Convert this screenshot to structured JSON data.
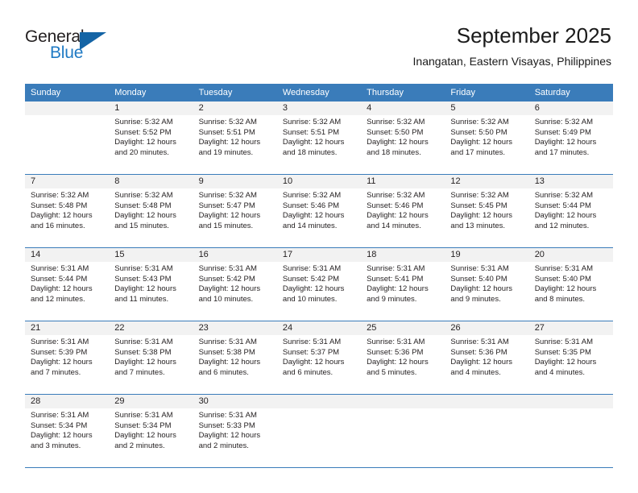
{
  "brand": {
    "name_top": "General",
    "name_bottom": "Blue",
    "flag_color": "#1464a5",
    "blue_color": "#1f7ac4"
  },
  "header": {
    "title": "September 2025",
    "subtitle": "Inangatan, Eastern Visayas, Philippines",
    "accent_color": "#3a7cba"
  },
  "calendar": {
    "weekday_headers": [
      "Sunday",
      "Monday",
      "Tuesday",
      "Wednesday",
      "Thursday",
      "Friday",
      "Saturday"
    ],
    "labels": {
      "sunrise_prefix": "Sunrise:",
      "sunset_prefix": "Sunset:",
      "daylight_prefix": "Daylight:"
    },
    "weeks": [
      [
        {
          "day": "",
          "sunrise": "",
          "sunset": "",
          "daylight_line1": "",
          "daylight_line2": ""
        },
        {
          "day": "1",
          "sunrise": "Sunrise: 5:32 AM",
          "sunset": "Sunset: 5:52 PM",
          "daylight_line1": "Daylight: 12 hours",
          "daylight_line2": "and 20 minutes."
        },
        {
          "day": "2",
          "sunrise": "Sunrise: 5:32 AM",
          "sunset": "Sunset: 5:51 PM",
          "daylight_line1": "Daylight: 12 hours",
          "daylight_line2": "and 19 minutes."
        },
        {
          "day": "3",
          "sunrise": "Sunrise: 5:32 AM",
          "sunset": "Sunset: 5:51 PM",
          "daylight_line1": "Daylight: 12 hours",
          "daylight_line2": "and 18 minutes."
        },
        {
          "day": "4",
          "sunrise": "Sunrise: 5:32 AM",
          "sunset": "Sunset: 5:50 PM",
          "daylight_line1": "Daylight: 12 hours",
          "daylight_line2": "and 18 minutes."
        },
        {
          "day": "5",
          "sunrise": "Sunrise: 5:32 AM",
          "sunset": "Sunset: 5:50 PM",
          "daylight_line1": "Daylight: 12 hours",
          "daylight_line2": "and 17 minutes."
        },
        {
          "day": "6",
          "sunrise": "Sunrise: 5:32 AM",
          "sunset": "Sunset: 5:49 PM",
          "daylight_line1": "Daylight: 12 hours",
          "daylight_line2": "and 17 minutes."
        }
      ],
      [
        {
          "day": "7",
          "sunrise": "Sunrise: 5:32 AM",
          "sunset": "Sunset: 5:48 PM",
          "daylight_line1": "Daylight: 12 hours",
          "daylight_line2": "and 16 minutes."
        },
        {
          "day": "8",
          "sunrise": "Sunrise: 5:32 AM",
          "sunset": "Sunset: 5:48 PM",
          "daylight_line1": "Daylight: 12 hours",
          "daylight_line2": "and 15 minutes."
        },
        {
          "day": "9",
          "sunrise": "Sunrise: 5:32 AM",
          "sunset": "Sunset: 5:47 PM",
          "daylight_line1": "Daylight: 12 hours",
          "daylight_line2": "and 15 minutes."
        },
        {
          "day": "10",
          "sunrise": "Sunrise: 5:32 AM",
          "sunset": "Sunset: 5:46 PM",
          "daylight_line1": "Daylight: 12 hours",
          "daylight_line2": "and 14 minutes."
        },
        {
          "day": "11",
          "sunrise": "Sunrise: 5:32 AM",
          "sunset": "Sunset: 5:46 PM",
          "daylight_line1": "Daylight: 12 hours",
          "daylight_line2": "and 14 minutes."
        },
        {
          "day": "12",
          "sunrise": "Sunrise: 5:32 AM",
          "sunset": "Sunset: 5:45 PM",
          "daylight_line1": "Daylight: 12 hours",
          "daylight_line2": "and 13 minutes."
        },
        {
          "day": "13",
          "sunrise": "Sunrise: 5:32 AM",
          "sunset": "Sunset: 5:44 PM",
          "daylight_line1": "Daylight: 12 hours",
          "daylight_line2": "and 12 minutes."
        }
      ],
      [
        {
          "day": "14",
          "sunrise": "Sunrise: 5:31 AM",
          "sunset": "Sunset: 5:44 PM",
          "daylight_line1": "Daylight: 12 hours",
          "daylight_line2": "and 12 minutes."
        },
        {
          "day": "15",
          "sunrise": "Sunrise: 5:31 AM",
          "sunset": "Sunset: 5:43 PM",
          "daylight_line1": "Daylight: 12 hours",
          "daylight_line2": "and 11 minutes."
        },
        {
          "day": "16",
          "sunrise": "Sunrise: 5:31 AM",
          "sunset": "Sunset: 5:42 PM",
          "daylight_line1": "Daylight: 12 hours",
          "daylight_line2": "and 10 minutes."
        },
        {
          "day": "17",
          "sunrise": "Sunrise: 5:31 AM",
          "sunset": "Sunset: 5:42 PM",
          "daylight_line1": "Daylight: 12 hours",
          "daylight_line2": "and 10 minutes."
        },
        {
          "day": "18",
          "sunrise": "Sunrise: 5:31 AM",
          "sunset": "Sunset: 5:41 PM",
          "daylight_line1": "Daylight: 12 hours",
          "daylight_line2": "and 9 minutes."
        },
        {
          "day": "19",
          "sunrise": "Sunrise: 5:31 AM",
          "sunset": "Sunset: 5:40 PM",
          "daylight_line1": "Daylight: 12 hours",
          "daylight_line2": "and 9 minutes."
        },
        {
          "day": "20",
          "sunrise": "Sunrise: 5:31 AM",
          "sunset": "Sunset: 5:40 PM",
          "daylight_line1": "Daylight: 12 hours",
          "daylight_line2": "and 8 minutes."
        }
      ],
      [
        {
          "day": "21",
          "sunrise": "Sunrise: 5:31 AM",
          "sunset": "Sunset: 5:39 PM",
          "daylight_line1": "Daylight: 12 hours",
          "daylight_line2": "and 7 minutes."
        },
        {
          "day": "22",
          "sunrise": "Sunrise: 5:31 AM",
          "sunset": "Sunset: 5:38 PM",
          "daylight_line1": "Daylight: 12 hours",
          "daylight_line2": "and 7 minutes."
        },
        {
          "day": "23",
          "sunrise": "Sunrise: 5:31 AM",
          "sunset": "Sunset: 5:38 PM",
          "daylight_line1": "Daylight: 12 hours",
          "daylight_line2": "and 6 minutes."
        },
        {
          "day": "24",
          "sunrise": "Sunrise: 5:31 AM",
          "sunset": "Sunset: 5:37 PM",
          "daylight_line1": "Daylight: 12 hours",
          "daylight_line2": "and 6 minutes."
        },
        {
          "day": "25",
          "sunrise": "Sunrise: 5:31 AM",
          "sunset": "Sunset: 5:36 PM",
          "daylight_line1": "Daylight: 12 hours",
          "daylight_line2": "and 5 minutes."
        },
        {
          "day": "26",
          "sunrise": "Sunrise: 5:31 AM",
          "sunset": "Sunset: 5:36 PM",
          "daylight_line1": "Daylight: 12 hours",
          "daylight_line2": "and 4 minutes."
        },
        {
          "day": "27",
          "sunrise": "Sunrise: 5:31 AM",
          "sunset": "Sunset: 5:35 PM",
          "daylight_line1": "Daylight: 12 hours",
          "daylight_line2": "and 4 minutes."
        }
      ],
      [
        {
          "day": "28",
          "sunrise": "Sunrise: 5:31 AM",
          "sunset": "Sunset: 5:34 PM",
          "daylight_line1": "Daylight: 12 hours",
          "daylight_line2": "and 3 minutes."
        },
        {
          "day": "29",
          "sunrise": "Sunrise: 5:31 AM",
          "sunset": "Sunset: 5:34 PM",
          "daylight_line1": "Daylight: 12 hours",
          "daylight_line2": "and 2 minutes."
        },
        {
          "day": "30",
          "sunrise": "Sunrise: 5:31 AM",
          "sunset": "Sunset: 5:33 PM",
          "daylight_line1": "Daylight: 12 hours",
          "daylight_line2": "and 2 minutes."
        },
        {
          "day": "",
          "sunrise": "",
          "sunset": "",
          "daylight_line1": "",
          "daylight_line2": ""
        },
        {
          "day": "",
          "sunrise": "",
          "sunset": "",
          "daylight_line1": "",
          "daylight_line2": ""
        },
        {
          "day": "",
          "sunrise": "",
          "sunset": "",
          "daylight_line1": "",
          "daylight_line2": ""
        },
        {
          "day": "",
          "sunrise": "",
          "sunset": "",
          "daylight_line1": "",
          "daylight_line2": ""
        }
      ]
    ]
  }
}
